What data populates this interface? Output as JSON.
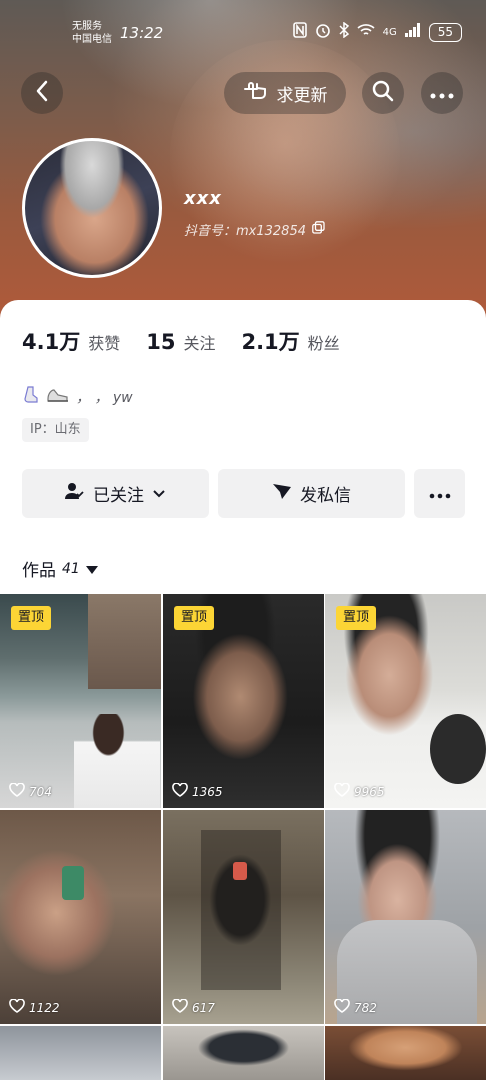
{
  "status_bar": {
    "carrier_line1": "无服务",
    "carrier_line2": "中国电信",
    "time": "13:22",
    "network": "4G",
    "battery": "55"
  },
  "nav": {
    "update_label": "求更新"
  },
  "profile": {
    "username": "xxx",
    "douyin_id": "抖音号：mx132854"
  },
  "stats": [
    {
      "value": "4.1万",
      "label": "获赞"
    },
    {
      "value": "15",
      "label": "关注"
    },
    {
      "value": "2.1万",
      "label": "粉丝"
    }
  ],
  "bio": {
    "text": "， ， yw",
    "ip": "IP：山东"
  },
  "actions": {
    "following_label": "已关注",
    "message_label": "发私信"
  },
  "works_tab": {
    "label": "作品",
    "count": "41"
  },
  "videos": [
    {
      "pinned": true,
      "pin_label": "置顶",
      "likes": "704"
    },
    {
      "pinned": true,
      "pin_label": "置顶",
      "likes": "1365"
    },
    {
      "pinned": true,
      "pin_label": "置顶",
      "likes": "9965"
    },
    {
      "pinned": false,
      "likes": "1122"
    },
    {
      "pinned": false,
      "likes": "617"
    },
    {
      "pinned": false,
      "likes": "782"
    }
  ],
  "colors": {
    "accent_pin": "#fcd535",
    "text_primary": "#161823",
    "button_bg": "#f1f1f2"
  }
}
